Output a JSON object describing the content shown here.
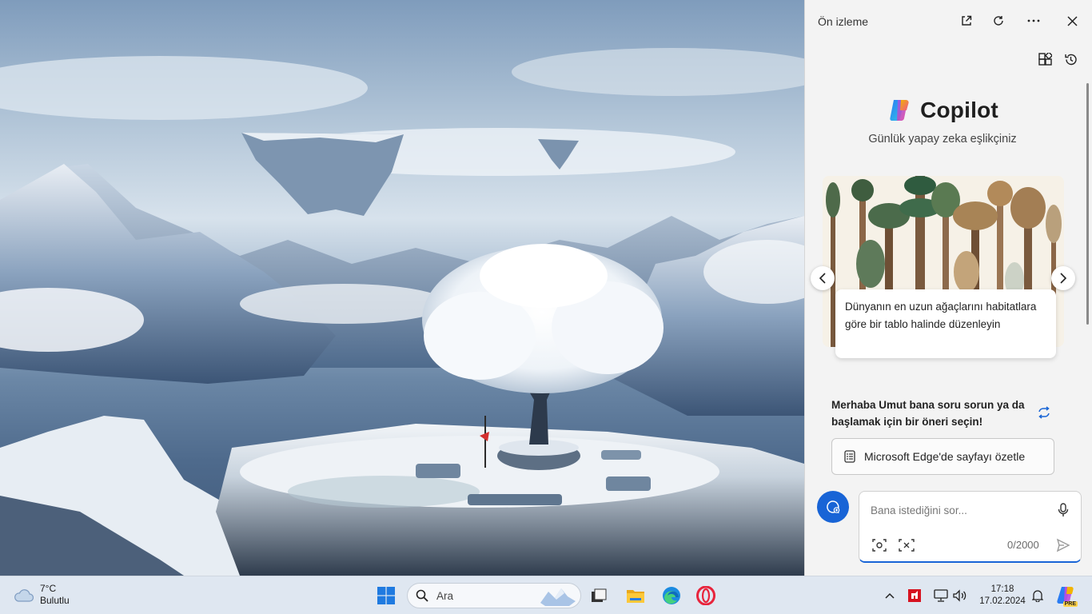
{
  "panel": {
    "title": "Ön izleme",
    "header_icons": [
      "open-in-new-icon",
      "refresh-icon",
      "more-icon",
      "close-icon"
    ],
    "toolbar_icons": [
      "plugins-icon",
      "history-icon"
    ],
    "brand": "Copilot",
    "tagline": "Günlük yapay zeka eşlikçiniz",
    "card": {
      "caption": "Dünyanın en uzun ağaçlarını habitatlara göre bir tablo halinde düzenleyin"
    },
    "greeting": "Merhaba Umut bana soru sorun ya da başlamak için bir öneri seçin!",
    "suggestion": "Microsoft Edge'de sayfayı özetle",
    "input": {
      "placeholder": "Bana istediğini sor...",
      "value": "",
      "counter": "0/2000"
    }
  },
  "taskbar": {
    "weather": {
      "temp": "7°C",
      "condition": "Bulutlu"
    },
    "search_placeholder": "Ara",
    "apps": [
      "start-icon",
      "task-view-icon",
      "file-explorer-icon",
      "edge-icon",
      "opera-icon"
    ],
    "tray": [
      "chevron-up-icon",
      "amd-icon",
      "network-icon",
      "volume-icon",
      "bell-icon",
      "copilot-pre-icon"
    ],
    "time": "17:18",
    "date": "17.02.2024",
    "copilot_badge": "PRE"
  },
  "colors": {
    "accent": "#1864d6",
    "panel_bg": "#f3f3f3",
    "taskbar_bg": "#dfe7f1"
  }
}
